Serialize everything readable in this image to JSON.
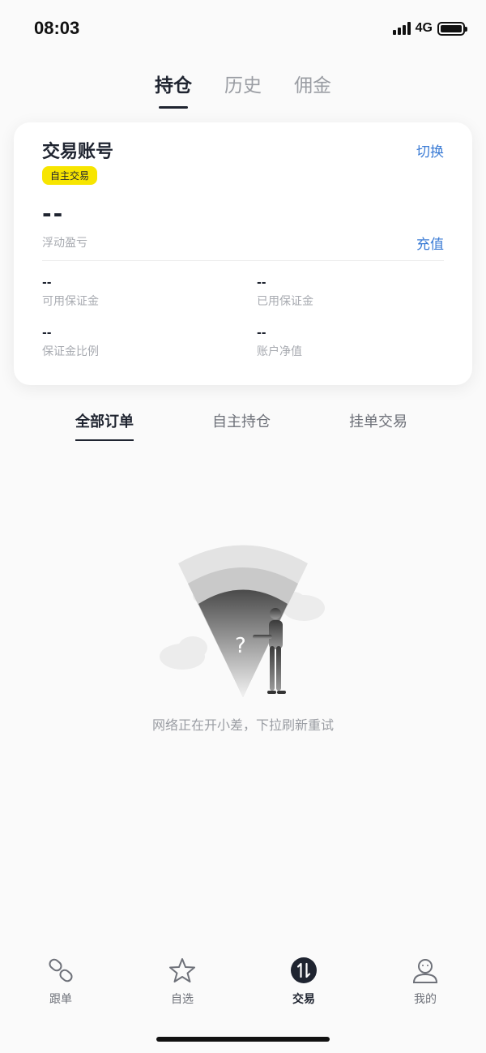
{
  "status_bar": {
    "time": "08:03",
    "network": "4G"
  },
  "top_tabs": [
    {
      "label": "持仓",
      "active": true
    },
    {
      "label": "历史",
      "active": false
    },
    {
      "label": "佣金",
      "active": false
    }
  ],
  "account": {
    "title": "交易账号",
    "switch_label": "切换",
    "badge": "自主交易",
    "floating_pnl_value": "--",
    "floating_pnl_label": "浮动盈亏",
    "recharge_label": "充值",
    "metrics": [
      {
        "value": "--",
        "label": "可用保证金"
      },
      {
        "value": "--",
        "label": "已用保证金"
      },
      {
        "value": "--",
        "label": "保证金比例"
      },
      {
        "value": "--",
        "label": "账户净值"
      }
    ]
  },
  "order_tabs": [
    {
      "label": "全部订单",
      "active": true
    },
    {
      "label": "自主持仓",
      "active": false
    },
    {
      "label": "挂单交易",
      "active": false
    }
  ],
  "empty_state": {
    "message": "网络正在开小差，下拉刷新重试"
  },
  "bottom_nav": [
    {
      "label": "跟单",
      "icon": "link-icon",
      "active": false
    },
    {
      "label": "自选",
      "icon": "star-icon",
      "active": false
    },
    {
      "label": "交易",
      "icon": "trade-icon",
      "active": true
    },
    {
      "label": "我的",
      "icon": "user-icon",
      "active": false
    }
  ],
  "colors": {
    "accent_blue": "#3a7bd5",
    "badge_yellow": "#f7e500",
    "primary_dark": "#1f2430"
  }
}
